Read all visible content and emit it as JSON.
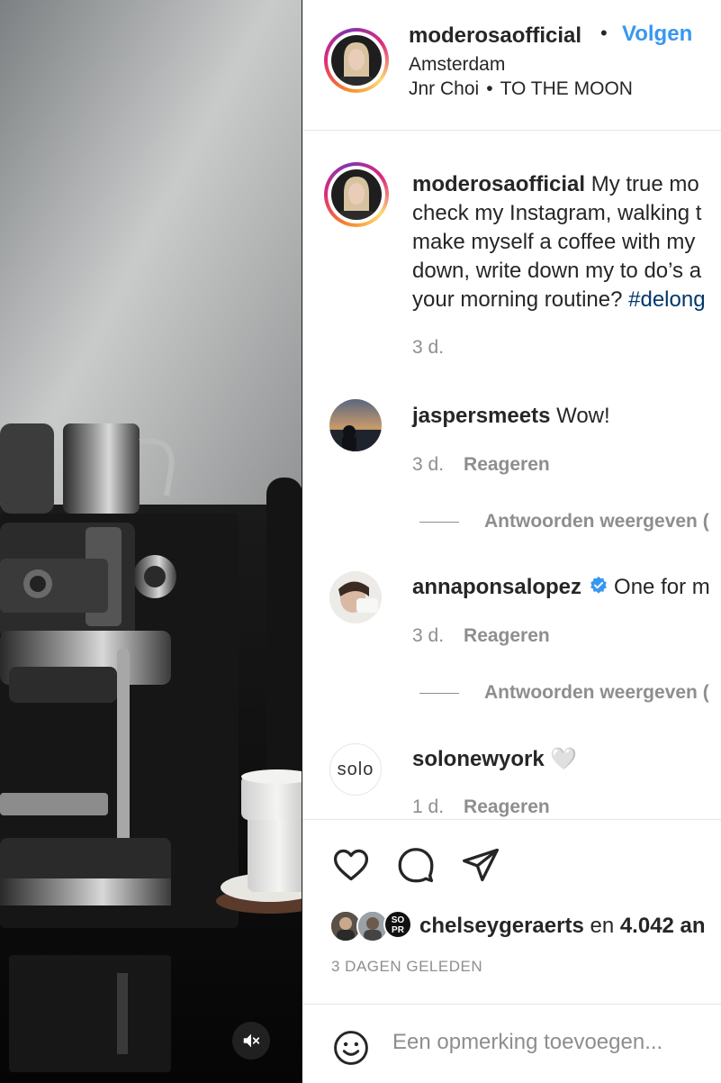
{
  "post": {
    "author": "moderosaofficial",
    "follow_label": "Volgen",
    "separator": "•",
    "location": "Amsterdam",
    "music_artist": "Jnr Choi",
    "music_track": "TO THE MOON"
  },
  "caption": {
    "username": "moderosaofficial",
    "line1": " My true mo",
    "line2": "check my Instagram, walking t",
    "line3": "make myself a coffee with my",
    "line4": "down, write down my to do’s a",
    "line5": "your morning routine? ",
    "hashtag": "#delong",
    "time": "3 d."
  },
  "comments": [
    {
      "username": "jaspersmeets",
      "text": " Wow!",
      "time": "3 d.",
      "reply_label": "Reageren",
      "view_replies": "Antwoorden weergeven ("
    },
    {
      "username": "annaponsalopez",
      "verified": true,
      "text": "One for m",
      "time": "3 d.",
      "reply_label": "Reageren",
      "view_replies": "Antwoorden weergeven ("
    },
    {
      "username": "solonewyork",
      "avatar_text": "solo",
      "text": " 🤍",
      "time": "1 d.",
      "reply_label": "Reageren"
    }
  ],
  "likes": {
    "badge_text_line1": "SO",
    "badge_text_line2": "PR",
    "user": "chelseygeraerts",
    "connector": " en ",
    "count_text": "4.042 an"
  },
  "post_date": "3 DAGEN GELEDEN",
  "add_comment": {
    "placeholder": "Een opmerking toevoegen..."
  },
  "colors": {
    "link_blue": "#3897f0",
    "hashtag": "#00376b",
    "secondary_text": "#8e8e8e",
    "verified": "#3897f0"
  },
  "icons": [
    "mute-icon",
    "heart-icon",
    "comment-icon",
    "share-icon",
    "emoji-icon",
    "verified-icon"
  ]
}
